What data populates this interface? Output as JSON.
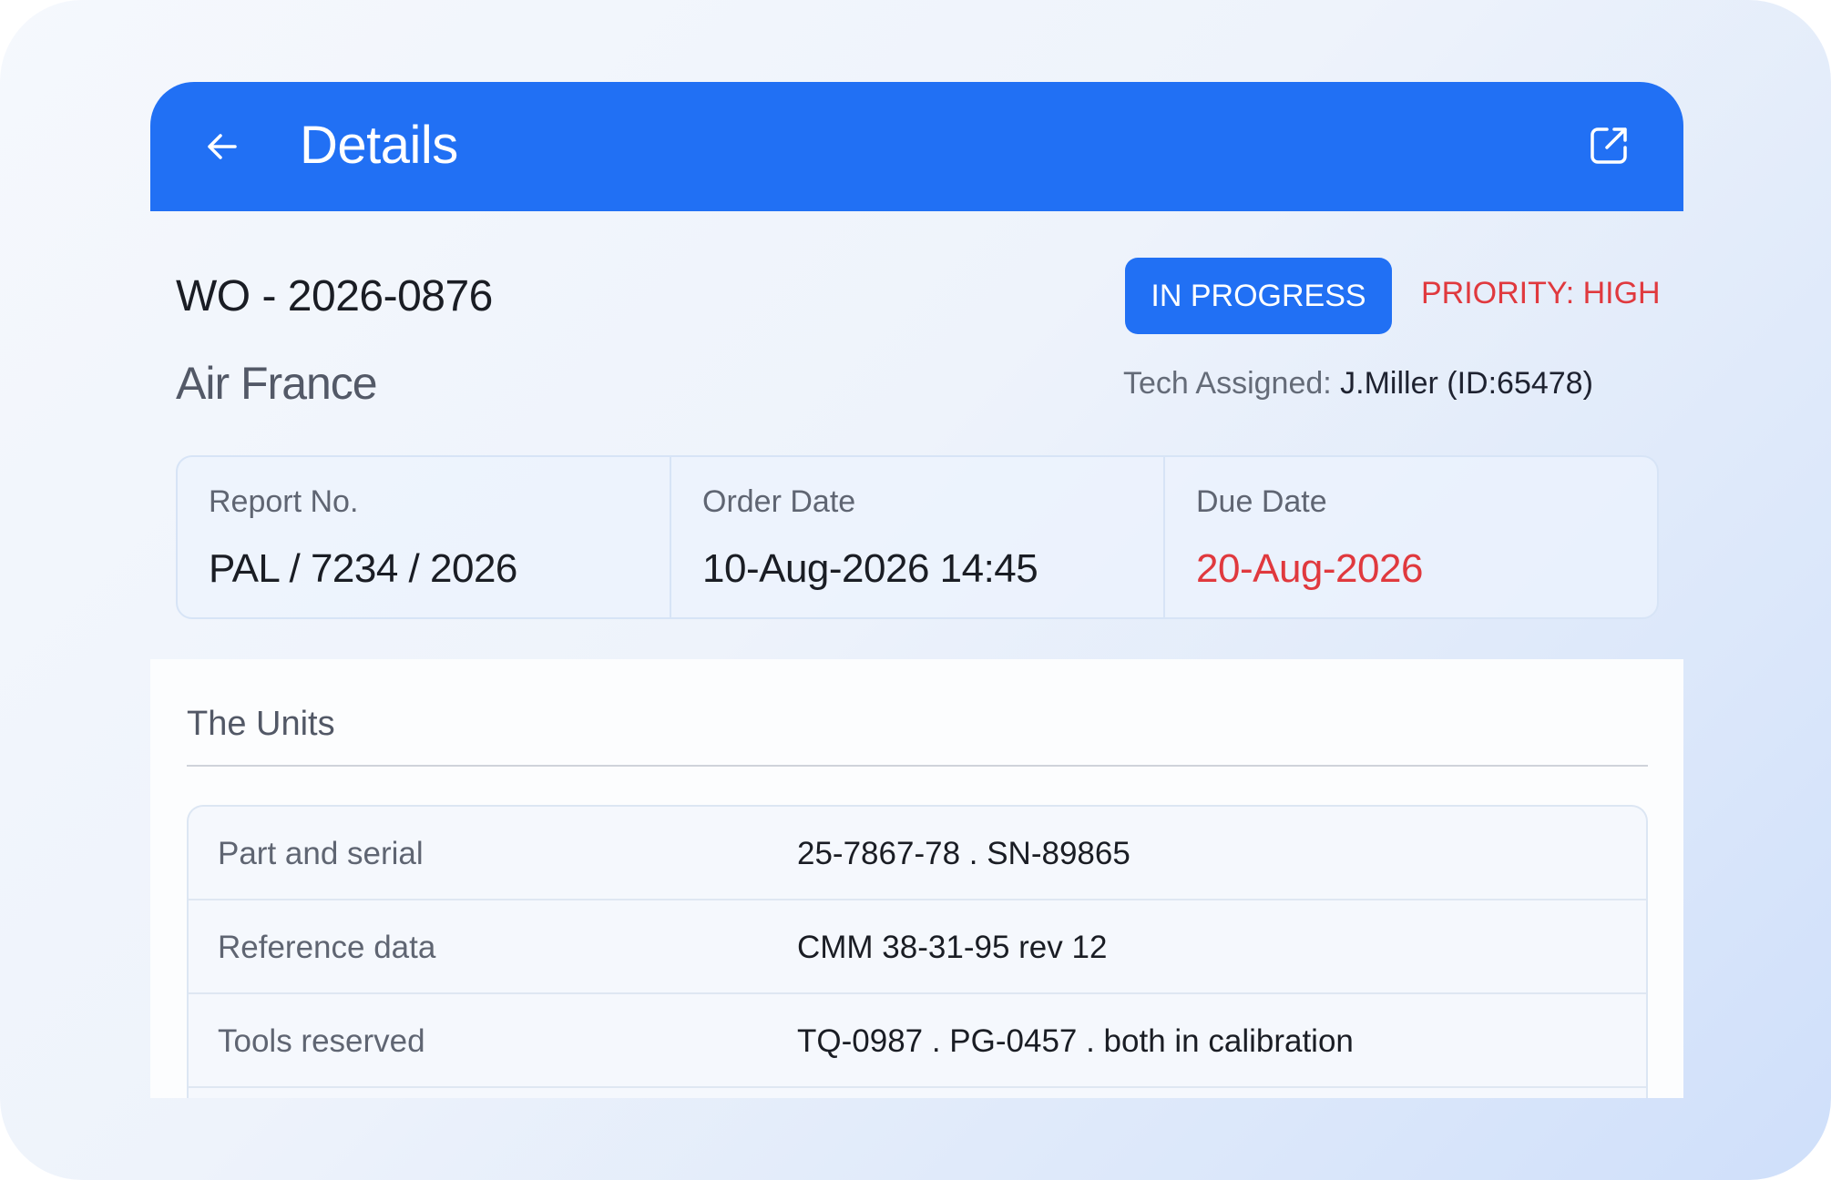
{
  "header": {
    "title": "Details",
    "back_icon": "arrow-left-icon",
    "open_icon": "external-link-icon",
    "color": "#2170f4"
  },
  "work_order": {
    "number": "WO - 2026-0876",
    "customer": "Air France",
    "status": "IN PROGRESS",
    "priority": "PRIORITY: HIGH",
    "tech_label": "Tech Assigned:",
    "tech_value": "J.Miller (ID:65478)"
  },
  "info": {
    "report_label": "Report No.",
    "report_value": "PAL / 7234 / 2026",
    "order_label": "Order Date",
    "order_value": "10-Aug-2026 14:45",
    "due_label": "Due Date",
    "due_value": "20-Aug-2026",
    "due_color": "#e0393e"
  },
  "units": {
    "title": "The Units",
    "rows": [
      {
        "label": "Part and serial",
        "value": "25-7867-78 . SN-89865"
      },
      {
        "label": "Reference data",
        "value": "CMM 38-31-95 rev 12"
      },
      {
        "label": "Tools reserved",
        "value": "TQ-0987 . PG-0457 . both in calibration"
      }
    ]
  }
}
